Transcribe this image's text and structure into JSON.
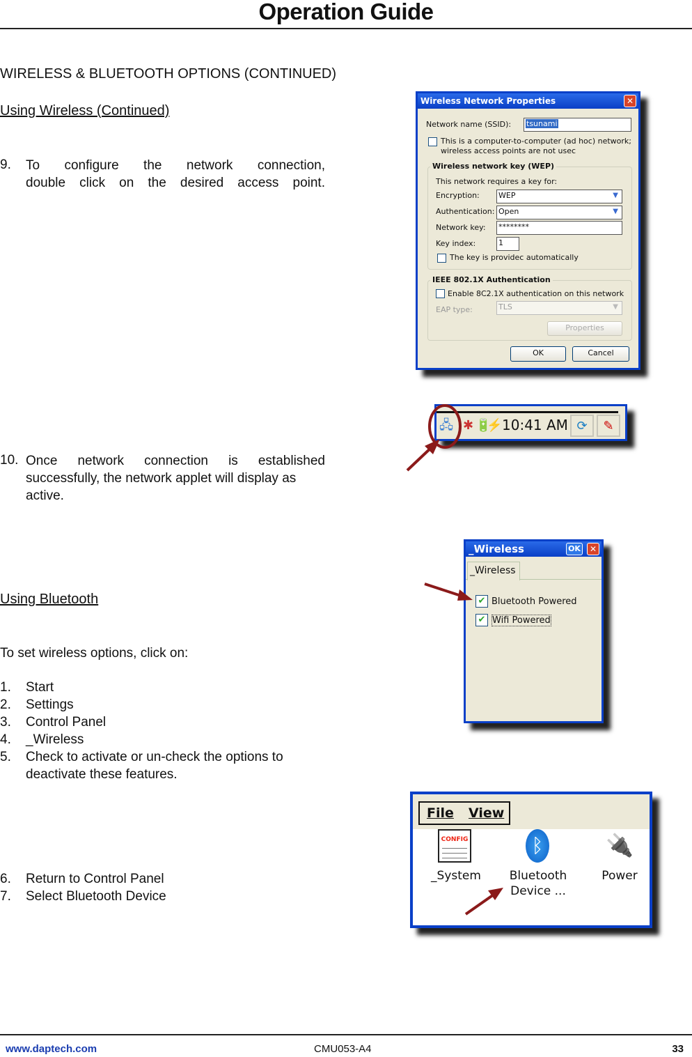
{
  "header": {
    "title": "Operation Guide"
  },
  "section_title": "WIRELESS & BLUETOOTH OPTIONS (CONTINUED)",
  "wireless": {
    "subhead": "Using Wireless (Continued)",
    "step9": {
      "num": "9.",
      "line1": "To configure the network connection,",
      "line2": "double click on the desired access point."
    },
    "step10": {
      "num": "10.",
      "line1": "Once network connection is established",
      "line2": "successfully, the network applet will display as",
      "line3": "active."
    }
  },
  "bluetooth": {
    "subhead": "Using Bluetooth",
    "intro": "To set wireless options, click on:",
    "steps": [
      {
        "num": "1.",
        "text": "Start"
      },
      {
        "num": "2.",
        "text": "Settings"
      },
      {
        "num": "3.",
        "text": "Control Panel"
      },
      {
        "num": "4.",
        "text": "_Wireless"
      },
      {
        "num": "5.",
        "text": "Check to activate or un-check the options to"
      },
      {
        "num": "",
        "text": "deactivate these features."
      },
      {
        "num": "6.",
        "text": "Return to Control Panel"
      },
      {
        "num": "7.",
        "text": "Select Bluetooth Device"
      }
    ]
  },
  "wnp_dialog": {
    "title": "Wireless Network Properties",
    "close": "✕",
    "ssid_label": "Network name (SSID):",
    "ssid_value": "tsunami",
    "adhoc_line1": "This is a computer-to-computer (ad hoc) network;",
    "adhoc_line2": "wireless access points are not usec",
    "adhoc_checked": false,
    "wep_group": "Wireless network key (WEP)",
    "requires": "This network requires a key for:",
    "encryption_label": "Encryption:",
    "encryption_value": "WEP",
    "auth_label": "Authentication:",
    "auth_value": "Open",
    "key_label": "Network key:",
    "key_value": "********",
    "index_label": "Key index:",
    "index_value": "1",
    "auto_key": "The key is providec automatically",
    "auto_key_checked": false,
    "ieee_group": "IEEE 802.1X Authentication",
    "enable_8021x": "Enable 8C2.1X authentication on this network",
    "enable_8021x_checked": false,
    "eap_label": "EAP type:",
    "eap_value": "TLS",
    "properties": "Properties",
    "ok": "OK",
    "cancel": "Cancel",
    "arrow_glyph": "⌄"
  },
  "taskbar": {
    "clock": "10:41 AM",
    "network_icon": "🖧",
    "tray_icons": [
      "✱",
      "🔋",
      "⚡"
    ],
    "btn1": "⟳",
    "btn2": "✎"
  },
  "wireless_applet": {
    "title": "_Wireless",
    "ok": "OK",
    "close": "✕",
    "tab": "_Wireless",
    "options": [
      {
        "label": "Bluetooth Powered",
        "checked": true
      },
      {
        "label": "Wifi Powered",
        "checked": true
      }
    ],
    "check_glyph": "✔"
  },
  "control_panel": {
    "menu": [
      "File",
      "View"
    ],
    "items": [
      {
        "label": "_System",
        "icon_text": "CONFIG"
      },
      {
        "label": "Bluetooth",
        "label2": "Device ...",
        "icon_text": "ᛒ"
      },
      {
        "label": "Power",
        "icon_text": "🔌"
      }
    ]
  },
  "footer": {
    "url": "www.daptech.com",
    "doc_id": "CMU053-A4",
    "page": "33"
  },
  "colors": {
    "annotation": "#8b1a1a",
    "window_border": "#0a40c8",
    "link": "#1a3db0"
  }
}
